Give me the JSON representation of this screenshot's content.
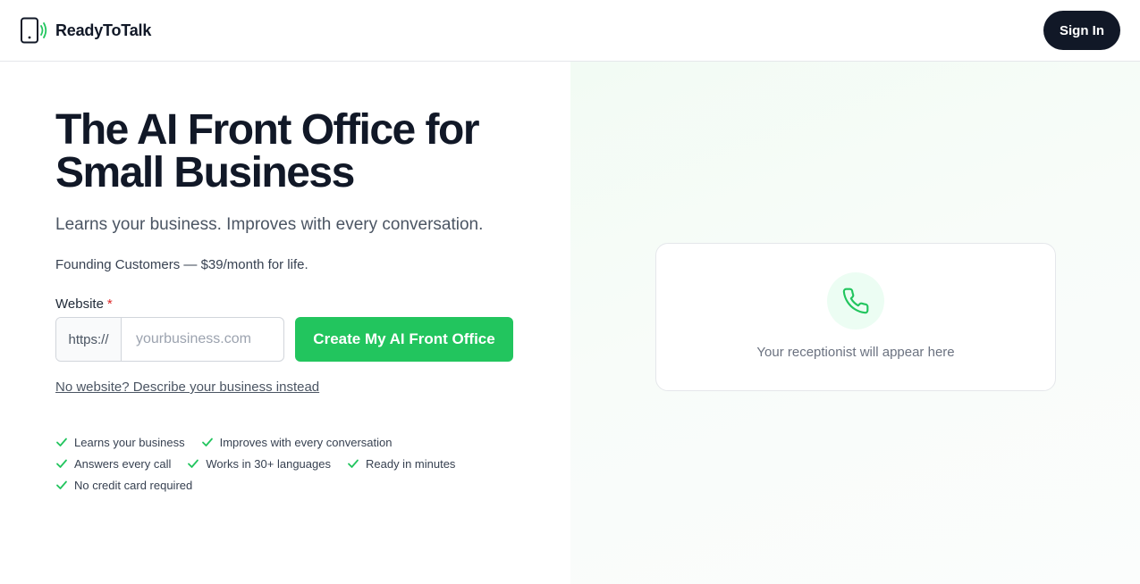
{
  "header": {
    "brand": "ReadyToTalk",
    "sign_in_label": "Sign In",
    "logo_icon": "phone-signal-icon"
  },
  "hero": {
    "headline": "The AI Front Office for Small Business",
    "subheadline": "Learns your business. Improves with every conversation.",
    "pricing": "Founding Customers — $39/month for life."
  },
  "form": {
    "website_label": "Website",
    "required_marker": "*",
    "url_prefix": "https://",
    "website_placeholder": "yourbusiness.com",
    "website_value": "",
    "submit_label": "Create My AI Front Office",
    "alt_link": "No website? Describe your business instead"
  },
  "features": [
    "Learns your business",
    "Improves with every conversation",
    "Answers every call",
    "Works in 30+ languages",
    "Ready in minutes",
    "No credit card required"
  ],
  "preview": {
    "placeholder_text": "Your receptionist will appear here",
    "icon": "phone-icon"
  },
  "colors": {
    "accent": "#22c55e",
    "dark": "#111827",
    "required": "#dc2626"
  }
}
